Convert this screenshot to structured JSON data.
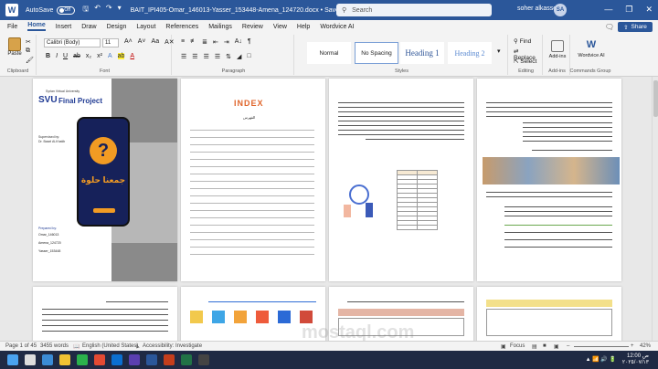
{
  "titlebar": {
    "autosave_label": "AutoSave",
    "autosave_state": "Off",
    "document_title": "BAIT_IPI405-Omar_146013-Yasser_153448-Amena_124720.docx • Saved",
    "search_placeholder": "Search",
    "user_name": "soher alkassem",
    "user_initials": "SA"
  },
  "menu": {
    "tabs": [
      "File",
      "Home",
      "Insert",
      "Draw",
      "Design",
      "Layout",
      "References",
      "Mailings",
      "Review",
      "View",
      "Help",
      "Wordvice AI"
    ],
    "active_tab": "Home",
    "share_label": "Share"
  },
  "ribbon": {
    "clipboard": {
      "paste_label": "Paste",
      "group_label": "Clipboard"
    },
    "font": {
      "font_name": "Calibri (Body)",
      "font_size": "11",
      "group_label": "Font"
    },
    "paragraph": {
      "group_label": "Paragraph"
    },
    "styles": {
      "items": [
        "Normal",
        "No Spacing",
        "Heading 1",
        "Heading 2"
      ],
      "group_label": "Styles"
    },
    "editing": {
      "find_label": "Find",
      "replace_label": "Replace",
      "select_label": "Select",
      "group_label": "Editing"
    },
    "addins": {
      "label": "Add-ins",
      "group_label": "Add-ins"
    },
    "wordvice": {
      "label": "Wordvice AI",
      "group_label": "Commands Group"
    }
  },
  "pages": {
    "cover": {
      "university": "Syrian Virtual University",
      "logo_text": "SVU",
      "title": "Final Project",
      "supervised_label": "Supervised by:",
      "supervisor": "Dr. Basel Al-Khatib",
      "app_title_ar": "جمعنا حلوة",
      "prepared_label": "Prepared by:",
      "student_1": "Omar_146013",
      "student_2": "Amena_124720",
      "student_3": "Yasser_153448"
    },
    "index_title": "INDEX",
    "index_subtitle": "الفهرس"
  },
  "status": {
    "page": "Page 1 of 45",
    "words": "3455 words",
    "language": "English (United States)",
    "accessibility": "Accessibility: Investigate",
    "focus": "Focus",
    "zoom": "42%"
  },
  "taskbar": {
    "time": "12:00 ص",
    "date": "٢٠٢٥/٠٧/١٣"
  },
  "watermark": "mostaql.com"
}
